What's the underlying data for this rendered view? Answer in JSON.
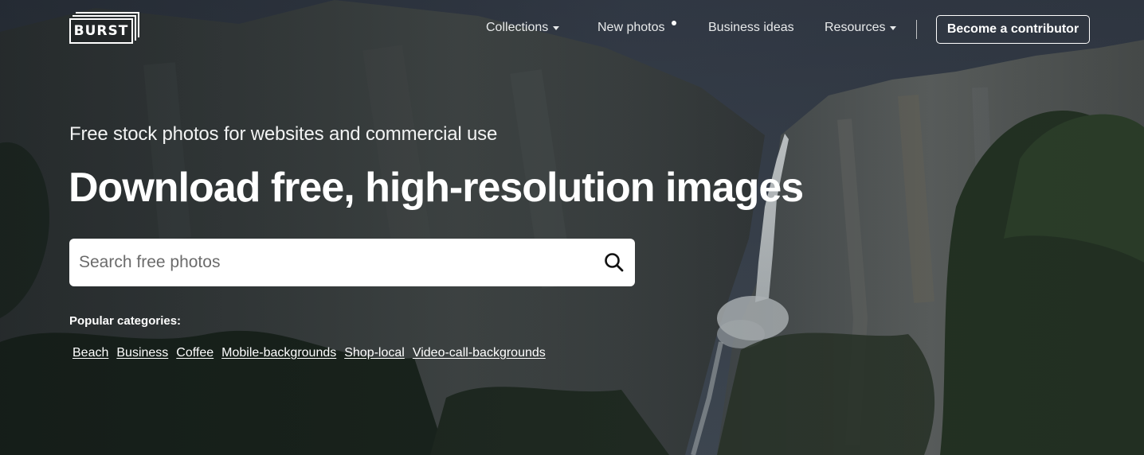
{
  "logo": {
    "text": "BURST"
  },
  "nav": {
    "items": [
      {
        "label": "Collections",
        "has_dropdown": true
      },
      {
        "label": "New photos",
        "has_indicator": true
      },
      {
        "label": "Business ideas"
      },
      {
        "label": "Resources",
        "has_dropdown": true
      }
    ],
    "cta_label": "Become a contributor"
  },
  "hero": {
    "tagline": "Free stock photos for websites and commercial use",
    "headline": "Download free, high-resolution images",
    "search": {
      "placeholder": "Search free photos",
      "value": ""
    },
    "popular_label": "Popular categories:",
    "categories": [
      "Beach",
      "Business",
      "Coffee",
      "Mobile-backgrounds",
      "Shop-local",
      "Video-call-backgrounds"
    ]
  },
  "icons": {
    "search": "search-icon",
    "dropdown": "caret-down-icon"
  },
  "colors": {
    "text": "#ffffff",
    "search_bg": "#ffffff",
    "search_text": "#6b6b6b"
  }
}
